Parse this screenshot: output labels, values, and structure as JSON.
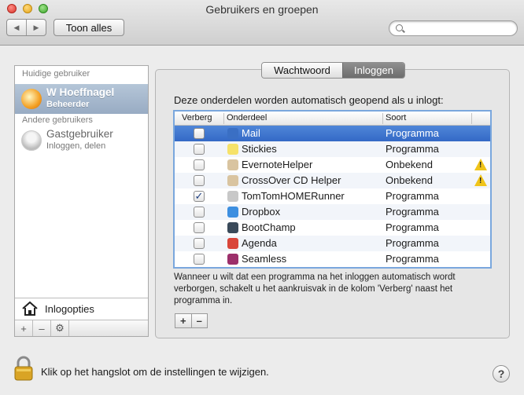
{
  "window": {
    "title": "Gebruikers en groepen"
  },
  "toolbar": {
    "back_glyph": "◀",
    "forward_glyph": "▶",
    "show_all_label": "Toon alles",
    "search_placeholder": ""
  },
  "sidebar": {
    "current_header": "Huidige gebruiker",
    "current_user": {
      "name": "W Hoeffnagel",
      "role": "Beheerder"
    },
    "other_header": "Andere gebruikers",
    "guest_user": {
      "name": "Gastgebruiker",
      "role": "Inloggen, delen"
    },
    "login_options_label": "Inlogopties",
    "add_glyph": "+",
    "remove_glyph": "–",
    "gear_glyph": "⚙"
  },
  "tabs": {
    "password_label": "Wachtwoord",
    "login_label": "Inloggen",
    "active": "Inloggen"
  },
  "main": {
    "intro": "Deze onderdelen worden automatisch geopend als u inlogt:",
    "columns": {
      "hide": "Verberg",
      "item": "Onderdeel",
      "kind": "Soort"
    },
    "items": [
      {
        "name": "Mail",
        "kind": "Programma",
        "hidden": false,
        "warning": false,
        "selected": true,
        "icon": "mail-icon",
        "color": "#3a6fc4"
      },
      {
        "name": "Stickies",
        "kind": "Programma",
        "hidden": false,
        "warning": false,
        "selected": false,
        "icon": "stickies-icon",
        "color": "#f6e26a"
      },
      {
        "name": "EvernoteHelper",
        "kind": "Onbekend",
        "hidden": false,
        "warning": true,
        "selected": false,
        "icon": "document-icon",
        "color": "#d9c4a0"
      },
      {
        "name": "CrossOver CD Helper",
        "kind": "Onbekend",
        "hidden": false,
        "warning": true,
        "selected": false,
        "icon": "document-icon",
        "color": "#d9c4a0"
      },
      {
        "name": "TomTomHOMERunner",
        "kind": "Programma",
        "hidden": true,
        "warning": false,
        "selected": false,
        "icon": "tomtom-icon",
        "color": "#c8c8c8"
      },
      {
        "name": "Dropbox",
        "kind": "Programma",
        "hidden": false,
        "warning": false,
        "selected": false,
        "icon": "dropbox-icon",
        "color": "#3d8fe0"
      },
      {
        "name": "BootChamp",
        "kind": "Programma",
        "hidden": false,
        "warning": false,
        "selected": false,
        "icon": "bootchamp-icon",
        "color": "#3a4a5a"
      },
      {
        "name": "Agenda",
        "kind": "Programma",
        "hidden": false,
        "warning": false,
        "selected": false,
        "icon": "calendar-icon",
        "color": "#d9463a"
      },
      {
        "name": "Seamless",
        "kind": "Programma",
        "hidden": false,
        "warning": false,
        "selected": false,
        "icon": "seamless-icon",
        "color": "#9c2f6b"
      }
    ],
    "note": "Wanneer u wilt dat een programma na het inloggen automatisch wordt verborgen, schakelt u het aankruisvak in de kolom 'Verberg' naast het programma in.",
    "add_glyph": "+",
    "remove_glyph": "–"
  },
  "footer": {
    "lock_text": "Klik op het hangslot om de instellingen te wijzigen.",
    "help_glyph": "?"
  }
}
